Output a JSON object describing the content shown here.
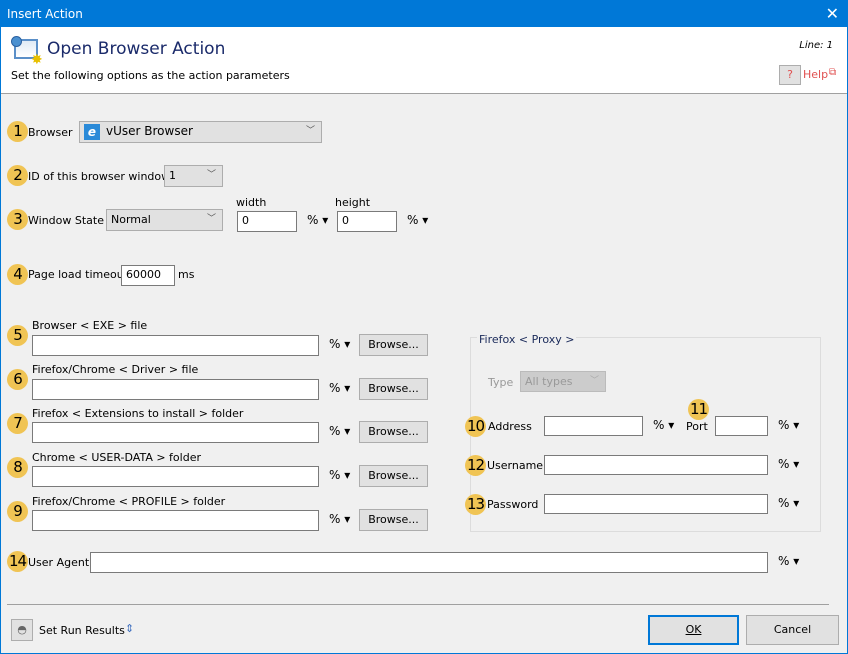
{
  "window": {
    "title": "Insert Action",
    "close": "✕"
  },
  "header": {
    "title": "Open Browser Action",
    "subtitle": "Set the following options as the action parameters",
    "line": "Line: 1",
    "help": "Help"
  },
  "badges": [
    "1",
    "2",
    "3",
    "4",
    "5",
    "6",
    "7",
    "8",
    "9",
    "10",
    "11",
    "12",
    "13",
    "14"
  ],
  "browser": {
    "label": "Browser",
    "value": "vUser Browser"
  },
  "window_id": {
    "label": "ID of this browser window",
    "value": "1"
  },
  "window_state": {
    "label": "Window State",
    "value": "Normal",
    "width_label": "width",
    "width": "0",
    "height_label": "height",
    "height": "0"
  },
  "timeout": {
    "label": "Page load timeout",
    "value": "60000",
    "unit": "ms"
  },
  "pct": "% ▾",
  "browse": "Browse...",
  "files": [
    {
      "label": "Browser < EXE > file",
      "value": ""
    },
    {
      "label": "Firefox/Chrome < Driver > file",
      "value": ""
    },
    {
      "label": "Firefox < Extensions to install > folder",
      "value": ""
    },
    {
      "label": "Chrome < USER-DATA > folder",
      "value": ""
    },
    {
      "label": "Firefox/Chrome < PROFILE > folder",
      "value": ""
    }
  ],
  "proxy": {
    "title": "Firefox < Proxy >",
    "type_label": "Type",
    "type_value": "All types",
    "address_label": "Address",
    "address": "",
    "port_label": "Port",
    "port": "",
    "username_label": "Username",
    "username": "",
    "password_label": "Password",
    "password": ""
  },
  "user_agent": {
    "label": "User Agent",
    "value": ""
  },
  "footer": {
    "set_run_results": "Set Run Results",
    "ok": "OK",
    "cancel": "Cancel"
  },
  "colors": {
    "titlebar": "#0078d7",
    "badge": "#f0c454",
    "help": "#e05050"
  }
}
